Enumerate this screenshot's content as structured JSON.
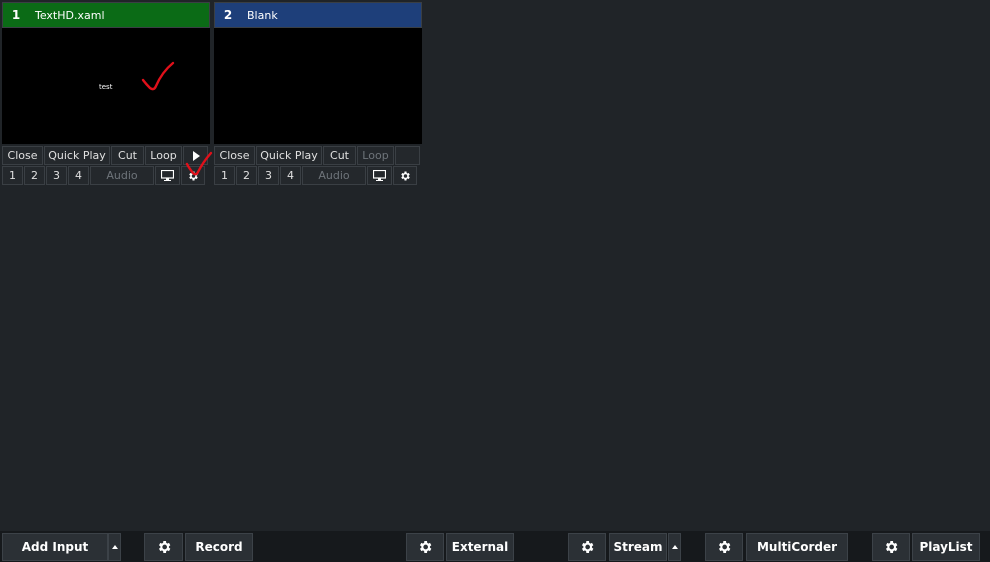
{
  "inputs": [
    {
      "number": "1",
      "title": "TextHD.xaml",
      "header_color": "#0b6b16",
      "preview_text": "test",
      "row1": [
        "Close",
        "Quick Play",
        "Cut",
        "Loop"
      ],
      "row2": [
        "1",
        "2",
        "3",
        "4",
        "Audio"
      ],
      "loop_enabled": true
    },
    {
      "number": "2",
      "title": "Blank",
      "header_color": "#1e3f7a",
      "preview_text": "",
      "row1": [
        "Close",
        "Quick Play",
        "Cut",
        "Loop"
      ],
      "row2": [
        "1",
        "2",
        "3",
        "4",
        "Audio"
      ],
      "loop_enabled": false
    }
  ],
  "icons": {
    "play": "play-icon",
    "monitor": "monitor-icon",
    "settings": "gear-icon",
    "dropdown": "caret-up-icon"
  },
  "annotation_color": "#e0101a",
  "bottom_bar": {
    "add_input": "Add Input",
    "record": "Record",
    "external": "External",
    "stream": "Stream",
    "multicorder": "MultiCorder",
    "playlist": "PlayList"
  }
}
